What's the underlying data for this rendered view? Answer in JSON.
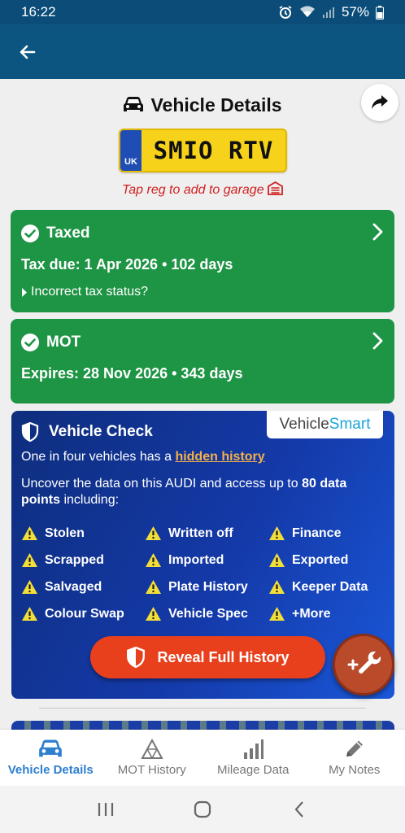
{
  "status": {
    "time": "16:22",
    "battery": "57%"
  },
  "header": {
    "title": "Vehicle Details",
    "back_icon": "arrow-left-icon",
    "share_icon": "share-icon"
  },
  "plate": {
    "country": "UK",
    "registration": "SMIO RTV"
  },
  "garage_hint": "Tap reg to add to garage",
  "tax": {
    "title": "Taxed",
    "due": "Tax due: 1 Apr 2026 • 102 days",
    "link": "Incorrect tax status?"
  },
  "mot": {
    "title": "MOT",
    "expires": "Expires: 28 Nov 2026 • 343 days"
  },
  "check": {
    "title": "Vehicle Check",
    "logo_a": "Vehicle",
    "logo_b": "Smart",
    "line1_pre": "One in four vehicles has a ",
    "line1_link": "hidden history",
    "line2_pre": "Uncover the data on this AUDI and access up to ",
    "line2_bold": "80 data points",
    "line2_post": " including:",
    "features": [
      "Stolen",
      "Written off",
      "Finance",
      "Scrapped",
      "Imported",
      "Exported",
      "Salvaged",
      "Plate History",
      "Keeper Data",
      "Colour Swap",
      "Vehicle Spec",
      "+More"
    ],
    "cta": "Reveal Full History"
  },
  "nav": {
    "items": [
      {
        "label": "Vehicle Details",
        "icon": "car-icon",
        "active": true
      },
      {
        "label": "MOT History",
        "icon": "mot-triangle-icon",
        "active": false
      },
      {
        "label": "Mileage Data",
        "icon": "bar-chart-icon",
        "active": false
      },
      {
        "label": "My Notes",
        "icon": "pencil-icon",
        "active": false
      }
    ]
  },
  "colors": {
    "accent": "#2e7fd0",
    "green": "#1e9445",
    "header": "#0d5581",
    "cta": "#e8401d",
    "plate": "#f6d21a"
  }
}
